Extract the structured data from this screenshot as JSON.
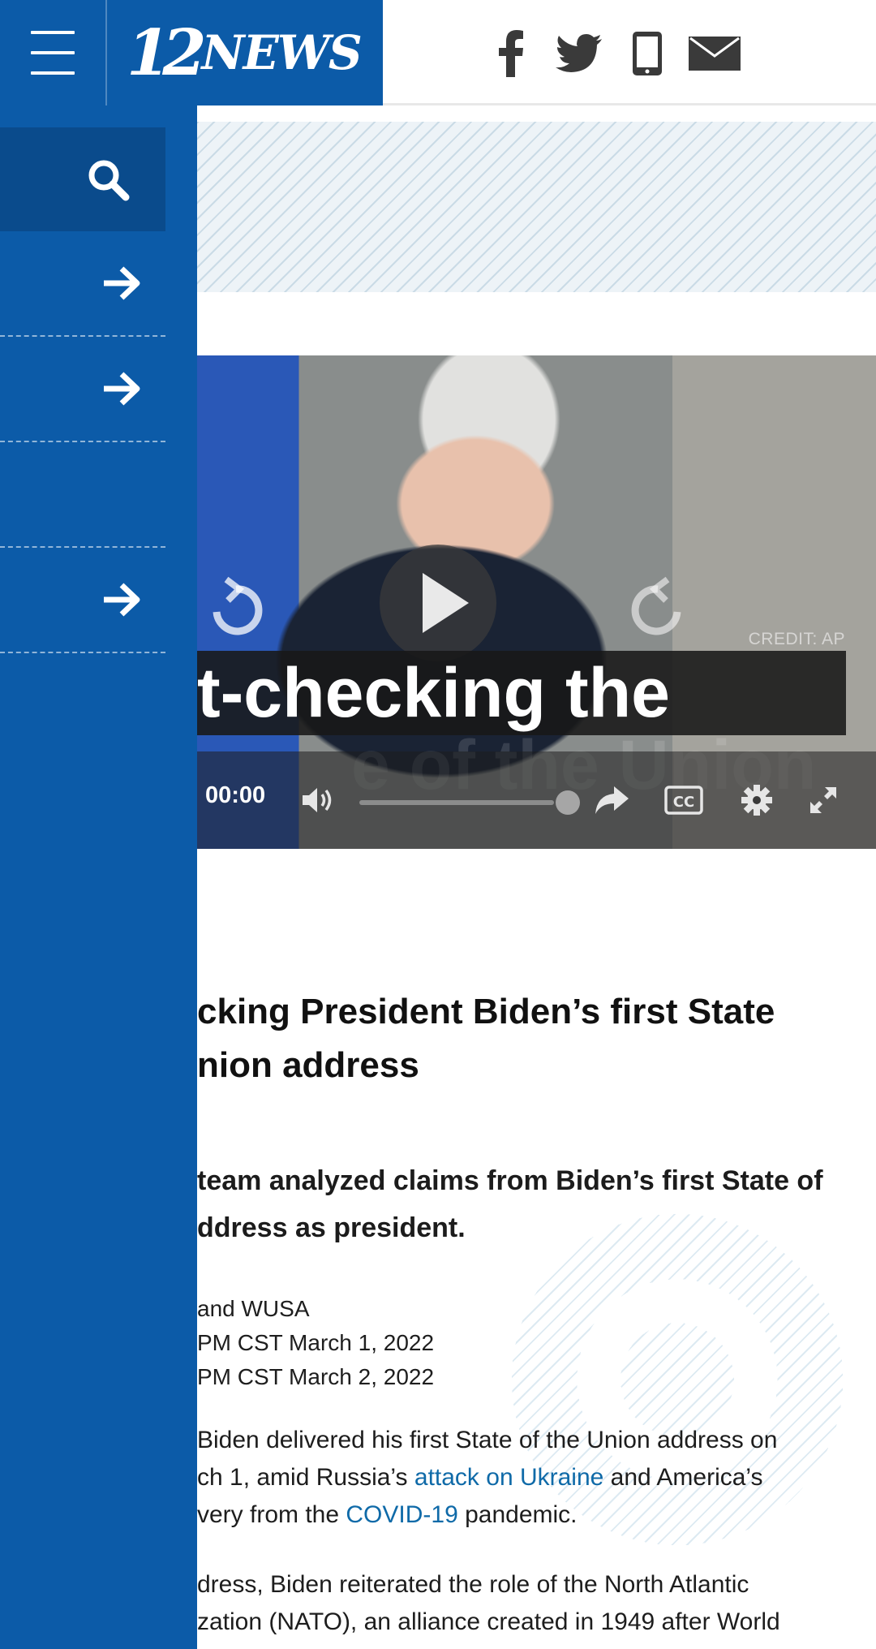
{
  "site": {
    "logo_number": "12",
    "logo_word": "NEWS"
  },
  "header": {
    "social_icons": [
      "facebook-icon",
      "twitter-icon",
      "mobile-phone-icon",
      "email-icon"
    ],
    "brand_color": "#0c5ba8"
  },
  "drawer": {
    "search_icon": "search-icon",
    "items": [
      {
        "label": "",
        "has_arrow": true
      },
      {
        "label": "",
        "has_arrow": true
      },
      {
        "label": "",
        "has_arrow": false
      },
      {
        "label": "",
        "has_arrow": true
      }
    ]
  },
  "video": {
    "credit": "CREDIT: AP",
    "title_line1": "t-checking the",
    "title_line2": "e of the Union",
    "time": "00:00",
    "progress_fraction": 0.0
  },
  "article": {
    "headline_line1": "cking President Biden’s first State",
    "headline_line2": "nion address",
    "subhead_line1": "team analyzed claims from Biden’s first State of",
    "subhead_line2": "ddress as president.",
    "byline": "and WUSA",
    "published": "PM CST March 1, 2022",
    "updated": "PM CST March 2, 2022",
    "p1_line1": "Biden delivered his first State of the Union address on",
    "p1_line2_pre": "ch 1, amid Russia’s ",
    "p1_link1": "attack on Ukraine",
    "p1_line2_post": " and America’s",
    "p1_line3_pre": "very from the ",
    "p1_link2": "COVID-19",
    "p1_line3_post": " pandemic.",
    "p2_line1": "dress, Biden reiterated the role of the North Atlantic",
    "p2_line2": "zation (NATO), an alliance created in 1949 after World"
  },
  "colors": {
    "link": "#0f6aa8",
    "drawer_search_bg": "#0a4b8c"
  }
}
